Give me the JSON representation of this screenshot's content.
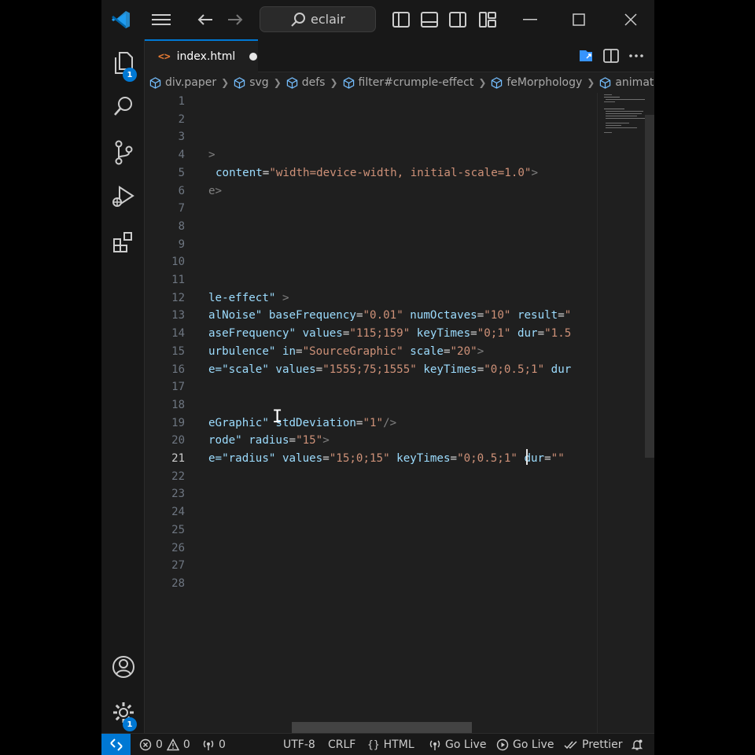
{
  "titlebar": {
    "search": "eclair"
  },
  "activitybar": {
    "explorer_badge": "1",
    "manage_badge": "1"
  },
  "tab": {
    "name": "index.html"
  },
  "breadcrumb": [
    "div.paper",
    "svg",
    "defs",
    "filter#crumple-effect",
    "feMorphology",
    "animate"
  ],
  "line_numbers": [
    "1",
    "2",
    "3",
    "4",
    "5",
    "6",
    "7",
    "8",
    "9",
    "10",
    "11",
    "12",
    "13",
    "14",
    "15",
    "16",
    "17",
    "18",
    "19",
    "20",
    "21",
    "22",
    "23",
    "24",
    "25",
    "26",
    "27",
    "28"
  ],
  "active_line": "21",
  "code": {
    "l4": [
      ">"
    ],
    "l5": [
      "content",
      "=",
      "\"width=device-width, initial-scale=1.0\"",
      ">"
    ],
    "l6": [
      "e>"
    ],
    "l12": [
      "le-effect\"",
      " >"
    ],
    "l13": [
      "alNoise\"",
      " baseFrequency",
      "=",
      "\"0.01\"",
      " numOctaves",
      "=",
      "\"10\"",
      " result",
      "=",
      "\""
    ],
    "l14": [
      "aseFrequency\"",
      " values",
      "=",
      "\"115;159\"",
      " keyTimes",
      "=",
      "\"0;1\"",
      " dur",
      "=",
      "\"1.5"
    ],
    "l15": [
      "urbulence\"",
      " in",
      "=",
      "\"SourceGraphic\"",
      " scale",
      "=",
      "\"20\"",
      ">"
    ],
    "l16": [
      "e=\"scale\"",
      " values",
      "=",
      "\"1555;75;1555\"",
      " keyTimes",
      "=",
      "\"0;0.5;1\"",
      " dur"
    ],
    "l19": [
      "eGraphic\"",
      " stdDeviation",
      "=",
      "\"1\"",
      "/>"
    ],
    "l20": [
      "rode\"",
      " radius",
      "=",
      "\"15\"",
      ">"
    ],
    "l21": [
      "e=\"radius\"",
      " values",
      "=",
      "\"15;0;15\"",
      " keyTimes",
      "=",
      "\"0;0.5;1\"",
      " dur",
      "=",
      "\"\""
    ]
  },
  "status": {
    "errors": "0",
    "warnings": "0",
    "ports": "0",
    "encoding": "UTF-8",
    "eol": "CRLF",
    "language": "HTML",
    "golive1": "Go Live",
    "golive2": "Go Live",
    "prettier": "Prettier"
  },
  "colors": {
    "accent": "#0078d4",
    "bg": "#1f1f1f",
    "chrome": "#181818"
  }
}
